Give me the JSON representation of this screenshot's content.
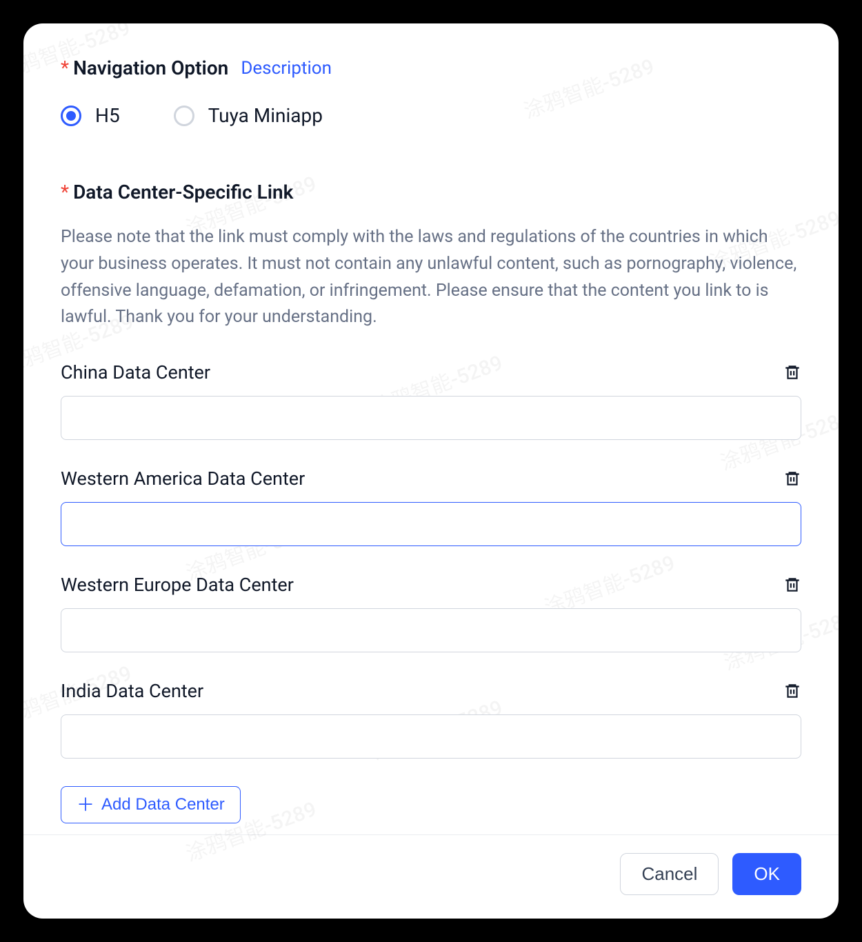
{
  "watermark_text": "涂鸦智能-5289",
  "nav_option": {
    "label": "Navigation Option",
    "description_link": "Description",
    "options": [
      {
        "label": "H5",
        "selected": true
      },
      {
        "label": "Tuya Miniapp",
        "selected": false
      }
    ]
  },
  "dc_link": {
    "label": "Data Center-Specific Link",
    "notice": "Please note that the link must comply with the laws and regulations of the countries in which your business operates. It must not contain any unlawful content, such as pornography, violence, offensive language, defamation, or infringement. Please ensure that the content you link to is lawful. Thank you for your understanding.",
    "centers": [
      {
        "name": "China Data Center",
        "value": "",
        "focused": false
      },
      {
        "name": "Western America Data Center",
        "value": "",
        "focused": true
      },
      {
        "name": "Western Europe Data Center",
        "value": "",
        "focused": false
      },
      {
        "name": "India Data Center",
        "value": "",
        "focused": false
      }
    ],
    "add_label": "Add Data Center"
  },
  "footer": {
    "cancel": "Cancel",
    "ok": "OK"
  }
}
